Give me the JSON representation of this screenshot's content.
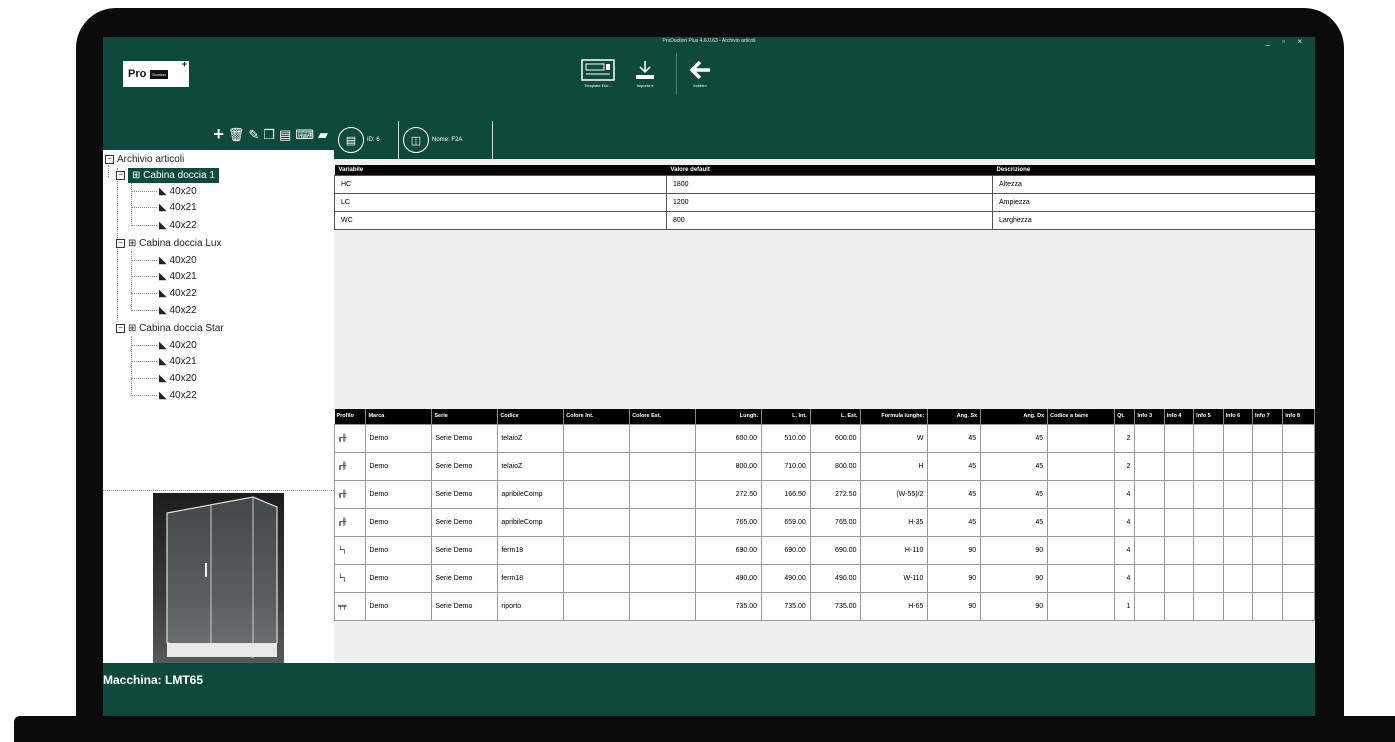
{
  "window": {
    "title": "ProDuction Plus 4.6.0.63 - Archivio articoli",
    "controls": "_ ▫ ×"
  },
  "logo": {
    "pro": "Pro",
    "duction": "Duction"
  },
  "toolbar": [
    {
      "label": "Template Etic...",
      "icon": "label-template-icon"
    },
    {
      "label": "Importa",
      "icon": "import-icon"
    },
    {
      "label": "Indietro",
      "icon": "back-arrow-icon"
    }
  ],
  "tree_toolbar": [
    "add-icon",
    "delete-icon",
    "edit-icon",
    "copy-icon",
    "document-icon",
    "keyboard-icon",
    "folder-icon"
  ],
  "tree": {
    "root": "Archivio articoli",
    "groups": [
      {
        "label": "Cabina doccia 1",
        "selected": true,
        "items": [
          "40x20",
          "40x21",
          "40x22"
        ]
      },
      {
        "label": "Cabina doccia Lux",
        "selected": false,
        "items": [
          "40x20",
          "40x21",
          "40x22",
          "40x22"
        ]
      },
      {
        "label": "Cabina doccia Star",
        "selected": false,
        "items": [
          "40x20",
          "40x21",
          "40x20",
          "40x22"
        ]
      }
    ]
  },
  "tabs": {
    "id": "ID: 6",
    "name": "Nome: F2A"
  },
  "variables": {
    "headers": [
      "Variabile",
      "Valore default",
      "Descrizione"
    ],
    "rows": [
      [
        "HC",
        "1800",
        "Altezza"
      ],
      [
        "LC",
        "1200",
        "Ampiezza"
      ],
      [
        "WC",
        "800",
        "Larghezza"
      ]
    ]
  },
  "parts": {
    "headers": [
      "Profilo",
      "Marca",
      "Serie",
      "Codice",
      "Colore Int.",
      "Colore Est.",
      "Lungh.",
      "L. Int.",
      "L. Est.",
      "Formula lunghe:",
      "Ang. Sx",
      "Ang. Dx",
      "Codice a barre",
      "Qt.",
      "Info 3",
      "Info 4",
      "Info 5",
      "Info 6",
      "Info 7",
      "Info 8"
    ],
    "rows": [
      [
        "╓╫",
        "Demo",
        "Serie Demo",
        "telaioZ",
        "",
        "",
        "600.00",
        "510.00",
        "600.00",
        "W",
        "45",
        "45",
        "",
        "2",
        "",
        "",
        "",
        "",
        "",
        ""
      ],
      [
        "╓╫",
        "Demo",
        "Serie Demo",
        "telaioZ",
        "",
        "",
        "800.00",
        "710.00",
        "800.00",
        "H",
        "45",
        "45",
        "",
        "2",
        "",
        "",
        "",
        "",
        "",
        ""
      ],
      [
        "╓╫",
        "Demo",
        "Serie Demo",
        "apribileComp",
        "",
        "",
        "272.50",
        "166.50",
        "272.50",
        "(W-55)/2",
        "45",
        "45",
        "",
        "4",
        "",
        "",
        "",
        "",
        "",
        ""
      ],
      [
        "╓╫",
        "Demo",
        "Serie Demo",
        "apribileComp",
        "",
        "",
        "765.00",
        "659.00",
        "765.00",
        "H-35",
        "45",
        "45",
        "",
        "4",
        "",
        "",
        "",
        "",
        "",
        ""
      ],
      [
        "└┐",
        "Demo",
        "Serie Demo",
        "ferm18",
        "",
        "",
        "690.00",
        "690.00",
        "690.00",
        "H-110",
        "90",
        "90",
        "",
        "4",
        "",
        "",
        "",
        "",
        "",
        ""
      ],
      [
        "└┐",
        "Demo",
        "Serie Demo",
        "ferm18",
        "",
        "",
        "490.00",
        "490.00",
        "490.00",
        "W-110",
        "90",
        "90",
        "",
        "4",
        "",
        "",
        "",
        "",
        "",
        ""
      ],
      [
        "╤╤",
        "Demo",
        "Serie Demo",
        "riporto",
        "",
        "",
        "735.00",
        "735.00",
        "735.00",
        "H-65",
        "90",
        "90",
        "",
        "1",
        "",
        "",
        "",
        "",
        "",
        ""
      ]
    ]
  },
  "status": {
    "machine": "Macchina:  LMT65"
  },
  "colors": {
    "theme": "#0e4a3c",
    "accent": "#ffffff"
  }
}
